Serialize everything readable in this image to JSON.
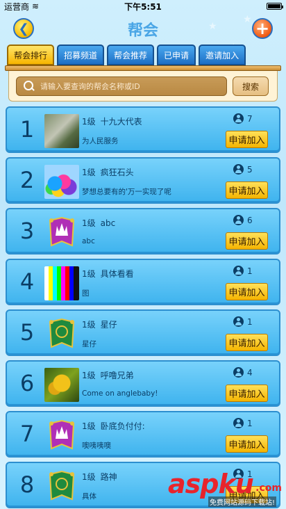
{
  "status_bar": {
    "carrier": "运营商",
    "time": "下午5:51"
  },
  "header": {
    "title": "帮会"
  },
  "tabs": [
    {
      "label": "帮会排行",
      "active": true
    },
    {
      "label": "招募频道",
      "active": false
    },
    {
      "label": "帮会推荐",
      "active": false
    },
    {
      "label": "已申请",
      "active": false
    },
    {
      "label": "邀请加入",
      "active": false
    }
  ],
  "search": {
    "placeholder": "请输入要查询的帮会名称或ID",
    "button_label": "搜索"
  },
  "guilds": [
    {
      "rank": "1",
      "level": "1级",
      "name": "十九大代表",
      "description": "为人民服务",
      "members": "7",
      "join_label": "申请加入",
      "avatar": "photo"
    },
    {
      "rank": "2",
      "level": "1级",
      "name": "疯狂石头",
      "description": "梦想总要有的'万一实现了呢",
      "members": "5",
      "join_label": "申请加入",
      "avatar": "balloons"
    },
    {
      "rank": "3",
      "level": "1级",
      "name": "abc",
      "description": "abc",
      "members": "6",
      "join_label": "申请加入",
      "avatar": "emblem-purple"
    },
    {
      "rank": "4",
      "level": "1级",
      "name": "具体看看",
      "description": "图",
      "members": "1",
      "join_label": "申请加入",
      "avatar": "testcard"
    },
    {
      "rank": "5",
      "level": "1级",
      "name": "星仔",
      "description": "星仔",
      "members": "1",
      "join_label": "申请加入",
      "avatar": "emblem-green"
    },
    {
      "rank": "6",
      "level": "1级",
      "name": "呼噜兄弟",
      "description": "Come on anglebaby!",
      "members": "4",
      "join_label": "申请加入",
      "avatar": "fruit"
    },
    {
      "rank": "7",
      "level": "1级",
      "name": "卧底负付付:",
      "description": "噢咦咦噢",
      "members": "1",
      "join_label": "申请加入",
      "avatar": "emblem-purple"
    },
    {
      "rank": "8",
      "level": "1级",
      "name": "路神",
      "description": "具体",
      "members": "1",
      "join_label": "申请加入",
      "avatar": "emblem-green"
    }
  ],
  "watermark": {
    "logo": "aspku",
    "tld": ".com",
    "tagline": "免费网站源码下载站!"
  },
  "colors": {
    "accent_blue": "#4aa6e6",
    "button_yellow": "#f4b400",
    "row_blue": "#3eb3ee"
  }
}
